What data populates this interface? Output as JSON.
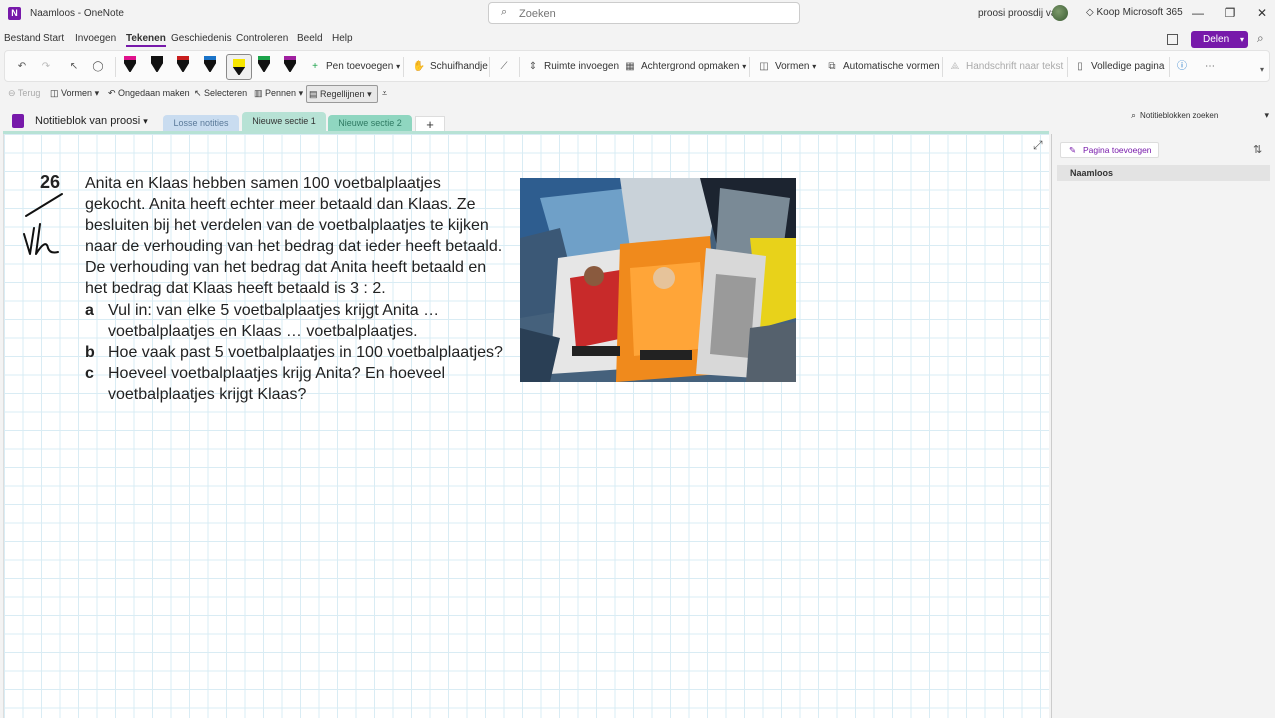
{
  "titlebar": {
    "doc_title": "Naamloos - OneNote",
    "search_placeholder": "Zoeken",
    "user_name": "proosi proosdij van",
    "buy_label": "Koop Microsoft 365"
  },
  "menu": {
    "items": [
      "Bestand",
      "Start",
      "Invoegen",
      "Tekenen",
      "Geschiedenis",
      "Controleren",
      "Beeld",
      "Help"
    ],
    "active": "Tekenen",
    "share_label": "Delen"
  },
  "ribbon": {
    "pens": [
      {
        "color": "#111111",
        "band": "#e0128c"
      },
      {
        "color": "#111111",
        "band": "#111111"
      },
      {
        "color": "#111111",
        "band": "#c81e1e"
      },
      {
        "color": "#111111",
        "band": "#1a73c8"
      },
      {
        "color": "#f7e600",
        "band": "#f7e600",
        "selected": true
      },
      {
        "color": "#111111",
        "band": "#1ba34a"
      },
      {
        "color": "#111111",
        "band": "#a020a0"
      }
    ],
    "add_pen": "Pen toevoegen",
    "hand": "Schuifhandje",
    "insert_space": "Ruimte invoegen",
    "background": "Achtergrond opmaken",
    "shapes": "Vormen",
    "auto_shapes": "Automatische vormen",
    "ink_to_text": "Handschrift naar tekst",
    "full_page": "Volledige pagina"
  },
  "ribbon2": {
    "back": "Terug",
    "shapes": "Vormen",
    "undo": "Ongedaan maken",
    "select": "Selecteren",
    "pens": "Pennen",
    "rule_lines": "Regellijnen"
  },
  "notebook": {
    "name": "Notitieblok van proosi",
    "sections": [
      {
        "label": "Losse notities",
        "color": "#c9dcf0",
        "text_color": "#5b7a9a"
      },
      {
        "label": "Nieuwe sectie 1",
        "color": "#b7e2d5",
        "text_color": "#333333",
        "active": true
      },
      {
        "label": "Nieuwe sectie 2",
        "color": "#8fd6c0",
        "text_color": "#2f7a63"
      }
    ],
    "search_placeholder": "Notitieblokken zoeken"
  },
  "note": {
    "number": "26",
    "intro": "Anita en Klaas hebben samen 100 voetbalplaatjes gekocht. Anita heeft echter meer betaald dan Klaas. Ze besluiten bij het verdelen van de voetbalplaatjes te kijken naar de verhouding van het bedrag dat ieder heeft betaald. De verhouding van het bedrag dat Anita heeft betaald en het bedrag dat Klaas heeft betaald is 3 : 2.",
    "parts": [
      {
        "letter": "a",
        "text": "Vul in: van elke 5 voetbalplaatjes krijgt Anita … voetbalplaatjes en Klaas … voetbalplaatjes."
      },
      {
        "letter": "b",
        "text": "Hoe vaak past 5 voetbalplaatjes in 100 voetbalplaatjes?"
      },
      {
        "letter": "c",
        "text": "Hoeveel voetbalplaatjes krijg Anita? En hoeveel voetbalplaatjes krijgt Klaas?"
      }
    ]
  },
  "pages": {
    "add_label": "Pagina toevoegen",
    "items": [
      "Naamloos"
    ]
  }
}
